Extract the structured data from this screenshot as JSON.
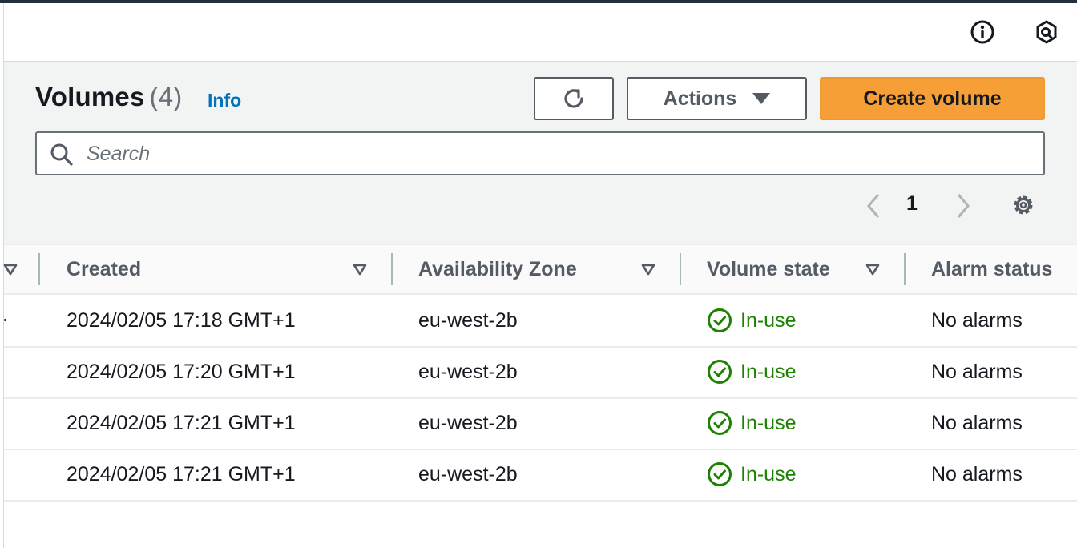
{
  "header": {
    "info_icon": "info-circle-icon",
    "notifications_icon": "shield-hexagon-icon"
  },
  "volumes": {
    "title": "Volumes",
    "count": "(4)",
    "info_link": "Info",
    "refresh_icon": "refresh-icon",
    "actions_label": "Actions",
    "create_label": "Create volume",
    "search_placeholder": "Search",
    "pagination": {
      "current_page": "1"
    },
    "accent_color": "#f59f36",
    "status_color": "#1d8102"
  },
  "table": {
    "columns": {
      "created": "Created",
      "availability_zone": "Availability Zone",
      "volume_state": "Volume state",
      "alarm_status": "Alarm status"
    },
    "rows": [
      {
        "created": "2024/02/05 17:18 GMT+1",
        "availability_zone": "eu-west-2b",
        "volume_state": "In-use",
        "alarm_status": "No alarms"
      },
      {
        "created": "2024/02/05 17:20 GMT+1",
        "availability_zone": "eu-west-2b",
        "volume_state": "In-use",
        "alarm_status": "No alarms"
      },
      {
        "created": "2024/02/05 17:21 GMT+1",
        "availability_zone": "eu-west-2b",
        "volume_state": "In-use",
        "alarm_status": "No alarms"
      },
      {
        "created": "2024/02/05 17:21 GMT+1",
        "availability_zone": "eu-west-2b",
        "volume_state": "In-use",
        "alarm_status": "No alarms"
      }
    ]
  }
}
